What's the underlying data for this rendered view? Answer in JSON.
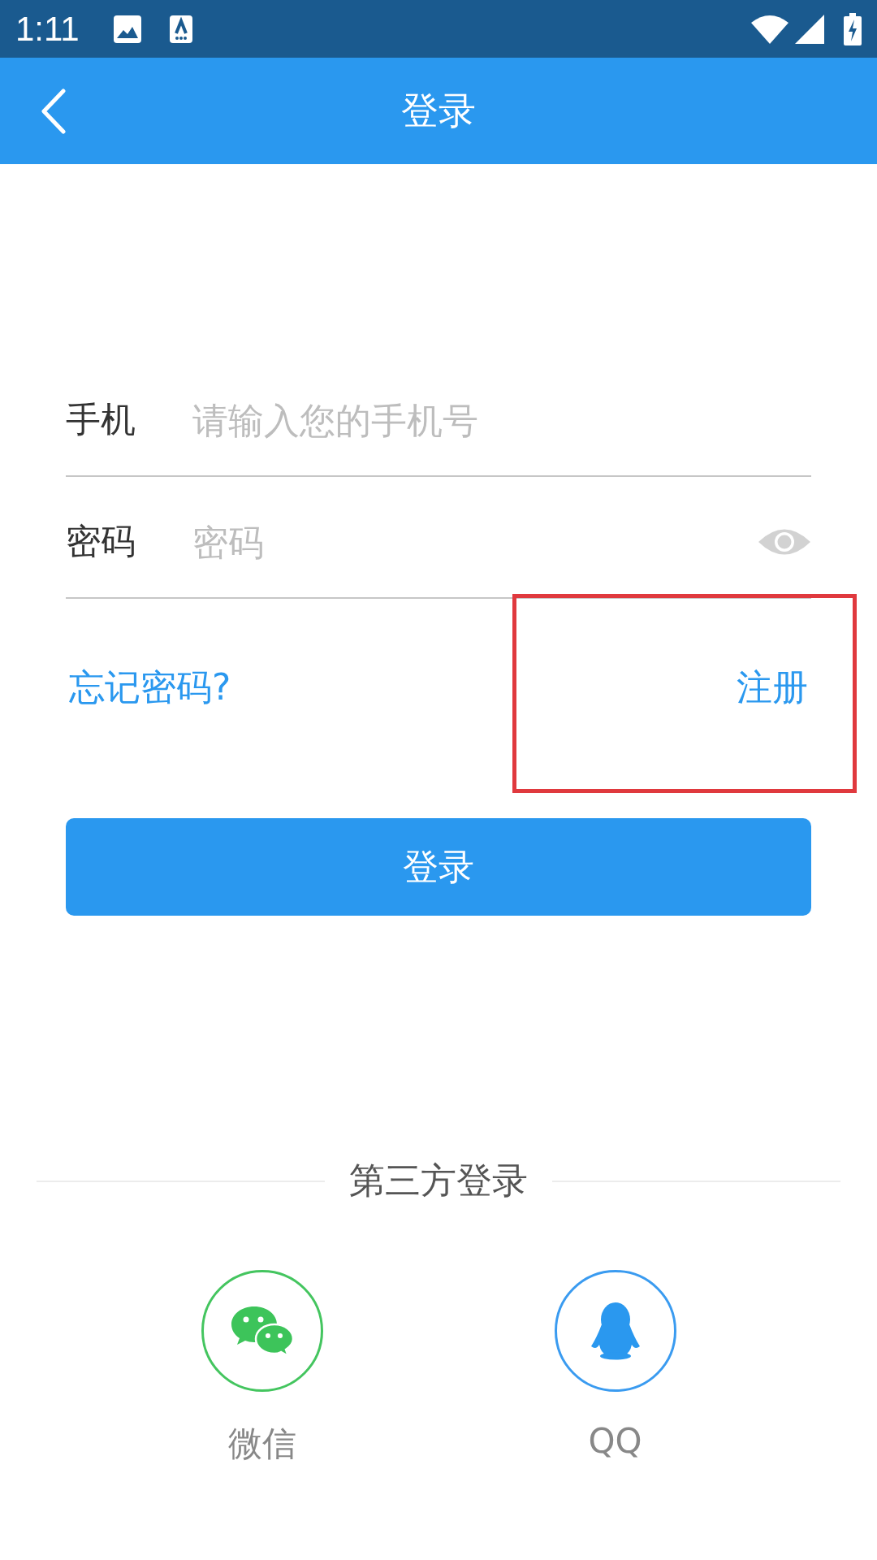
{
  "status_bar": {
    "time": "1:11"
  },
  "app_bar": {
    "title": "登录"
  },
  "form": {
    "fields": [
      {
        "kind": "text",
        "label": "手机",
        "placeholder": "请输入您的手机号"
      },
      {
        "kind": "password",
        "label": "密码",
        "placeholder": "密码"
      }
    ]
  },
  "links": [
    {
      "label": "忘记密码?",
      "highlighted": false
    },
    {
      "label": "注册",
      "highlighted": true
    }
  ],
  "login_button": {
    "label": "登录"
  },
  "third_party": {
    "title": "第三方登录",
    "options": [
      {
        "kind": "wechat",
        "label": "微信"
      },
      {
        "kind": "qq",
        "label": "QQ"
      }
    ]
  }
}
